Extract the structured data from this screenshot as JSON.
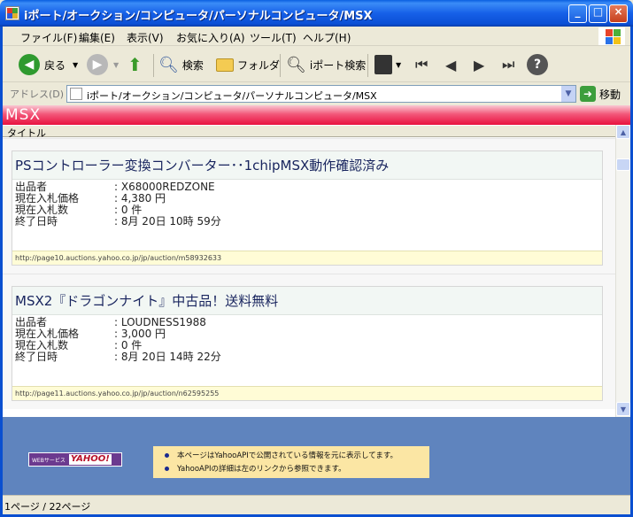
{
  "window": {
    "title": "iポート/オークション/コンピュータ/パーソナルコンピュータ/MSX"
  },
  "menu": [
    "ファイル(F)",
    "編集(E)",
    "表示(V)",
    "お気に入り(A)",
    "ツール(T)",
    "ヘルプ(H)"
  ],
  "toolbar": {
    "back": "戻る",
    "search": "検索",
    "folders": "フォルダ",
    "iport_search": "iポート検索"
  },
  "address": {
    "label": "アドレス(D)",
    "value": "iポート/オークション/コンピュータ/パーソナルコンピュータ/MSX",
    "go": "移動"
  },
  "page": {
    "heading": "MSX",
    "column_header": "タイトル"
  },
  "items": [
    {
      "title": "PSコントローラー変換コンバーター･･1chipMSX動作確認済み",
      "fields": [
        {
          "k": "出品者",
          "v": ": X68000REDZONE"
        },
        {
          "k": "現在入札価格",
          "v": ": 4,380 円"
        },
        {
          "k": "現在入札数",
          "v": ": 0 件"
        },
        {
          "k": "終了日時",
          "v": ": 8月 20日 10時 59分"
        }
      ],
      "url": "http://page10.auctions.yahoo.co.jp/jp/auction/m58932633"
    },
    {
      "title": "MSX2『ドラゴンナイト』中古品！送料無料",
      "fields": [
        {
          "k": "出品者",
          "v": ": LOUDNESS1988"
        },
        {
          "k": "現在入札価格",
          "v": ": 3,000 円"
        },
        {
          "k": "現在入札数",
          "v": ": 0 件"
        },
        {
          "k": "終了日時",
          "v": ": 8月 20日 14時 22分"
        }
      ],
      "url": "http://page11.auctions.yahoo.co.jp/jp/auction/n62595255"
    }
  ],
  "footer": {
    "badge_small": "WEBサービス",
    "badge_brand": "YAHOO!",
    "notices": [
      "本ページはYahooAPIで公開されている情報を元に表示してます。",
      "YahooAPIの詳細は左のリンクから参照できます。"
    ]
  },
  "status": {
    "text": "1ページ / 22ページ"
  },
  "colors": {
    "titlebar": "#1660e8",
    "page_heading": "#e8123f",
    "footer": "#5f84be"
  }
}
